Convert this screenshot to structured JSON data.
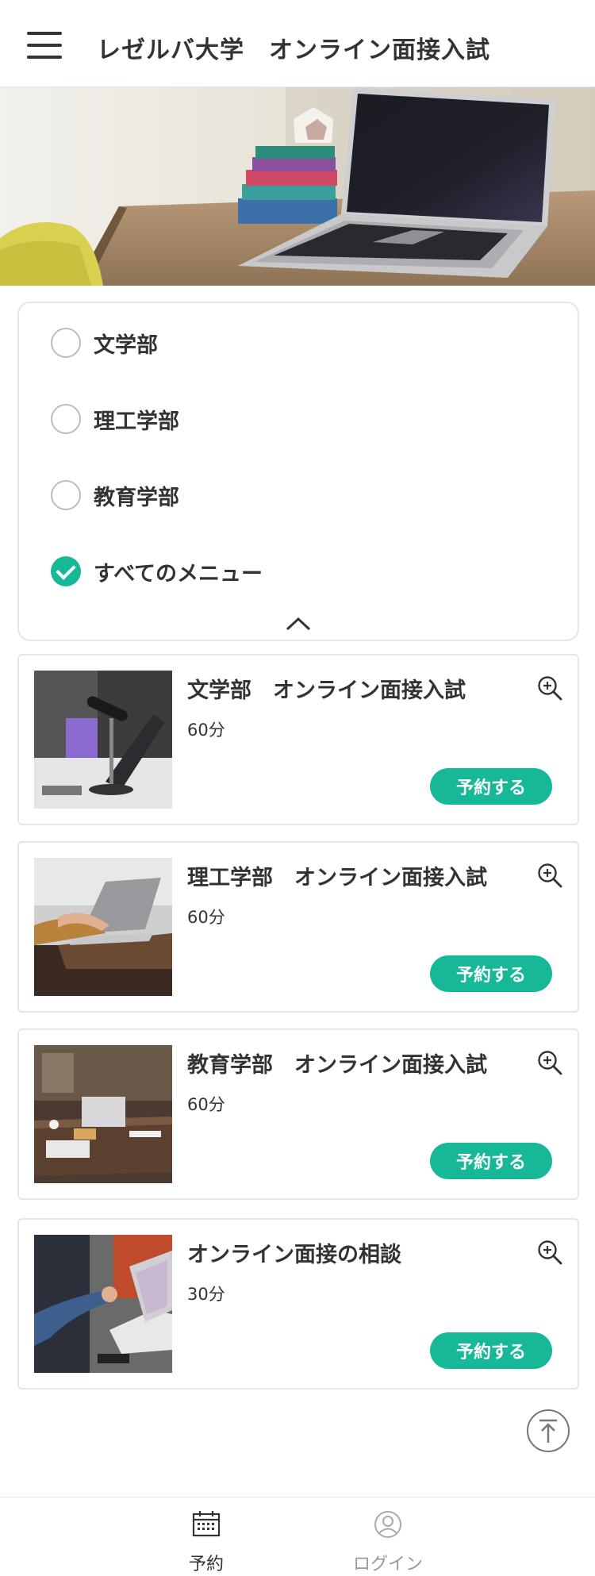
{
  "header": {
    "title": "レゼルバ大学　オンライン面接入試"
  },
  "categories": [
    {
      "label": "文学部",
      "checked": false
    },
    {
      "label": "理工学部",
      "checked": false
    },
    {
      "label": "教育学部",
      "checked": false
    },
    {
      "label": "すべてのメニュー",
      "checked": true
    }
  ],
  "services": [
    {
      "title": "文学部　オンライン面接入試",
      "duration": "60分",
      "button": "予約する"
    },
    {
      "title": "理工学部　オンライン面接入試",
      "duration": "60分",
      "button": "予約する"
    },
    {
      "title": "教育学部　オンライン面接入試",
      "duration": "60分",
      "button": "予約する"
    },
    {
      "title": "オンライン面接の相談",
      "duration": "30分",
      "button": "予約する"
    }
  ],
  "bottom_nav": {
    "reserve_label": "予約",
    "login_label": "ログイン"
  },
  "icons": {
    "menu": "hamburger-icon",
    "zoom": "zoom-in-icon",
    "collapse": "chevron-up-icon",
    "to_top": "arrow-up-icon",
    "reserve": "calendar-icon",
    "login": "user-icon"
  },
  "colors": {
    "accent": "#17b898",
    "text": "#333333",
    "border": "#e6e6e6",
    "muted": "#999999"
  }
}
